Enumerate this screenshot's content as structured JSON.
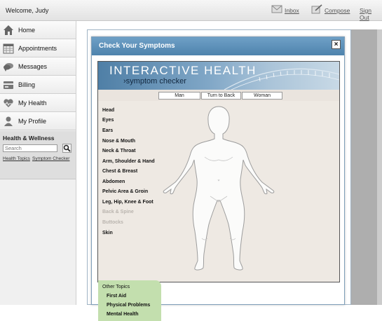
{
  "topbar": {
    "welcome": "Welcome, Judy",
    "links": [
      {
        "label": "Inbox",
        "icon": "envelope-icon"
      },
      {
        "label": "Compose",
        "icon": "compose-icon"
      },
      {
        "label": "Sign Out"
      }
    ]
  },
  "sidebar": {
    "items": [
      {
        "label": "Home",
        "icon": "home-icon"
      },
      {
        "label": "Appointments",
        "icon": "calendar-icon"
      },
      {
        "label": "Messages",
        "icon": "chat-bubble-icon"
      },
      {
        "label": "Billing",
        "icon": "billing-icon"
      },
      {
        "label": "My Health",
        "icon": "heart-icon"
      },
      {
        "label": "My Profile",
        "icon": "person-icon"
      }
    ],
    "health_wellness": {
      "title": "Health & Wellness",
      "search_placeholder": "Search",
      "links": [
        "Health Topics",
        "Symptom Checker"
      ]
    }
  },
  "modal": {
    "title": "Check Your Symptoms",
    "close_label": "×",
    "checker": {
      "banner_title": "INTERACTIVE HEALTH",
      "banner_sub": "›symptom checker",
      "toggles": [
        "Man",
        "Turn to Back",
        "Woman"
      ],
      "body_parts": [
        {
          "label": "Head",
          "enabled": true
        },
        {
          "label": "Eyes",
          "enabled": true
        },
        {
          "label": "Ears",
          "enabled": true
        },
        {
          "label": "Nose & Mouth",
          "enabled": true
        },
        {
          "label": "Neck & Throat",
          "enabled": true
        },
        {
          "label": "Arm, Shoulder & Hand",
          "enabled": true
        },
        {
          "label": "Chest & Breast",
          "enabled": true
        },
        {
          "label": "Abdomen",
          "enabled": true
        },
        {
          "label": "Pelvic Area & Groin",
          "enabled": true
        },
        {
          "label": "Leg, Hip, Knee & Foot",
          "enabled": true
        },
        {
          "label": "Back & Spine",
          "enabled": false
        },
        {
          "label": "Buttocks",
          "enabled": false
        },
        {
          "label": "Skin",
          "enabled": true
        }
      ],
      "other_topics": {
        "title": "Other Topics",
        "items": [
          "First Aid",
          "Physical Problems",
          "Mental Health"
        ]
      }
    }
  },
  "colors": {
    "modal_header": "#5b8fb9",
    "other_topics_bg": "#c3dfae"
  }
}
